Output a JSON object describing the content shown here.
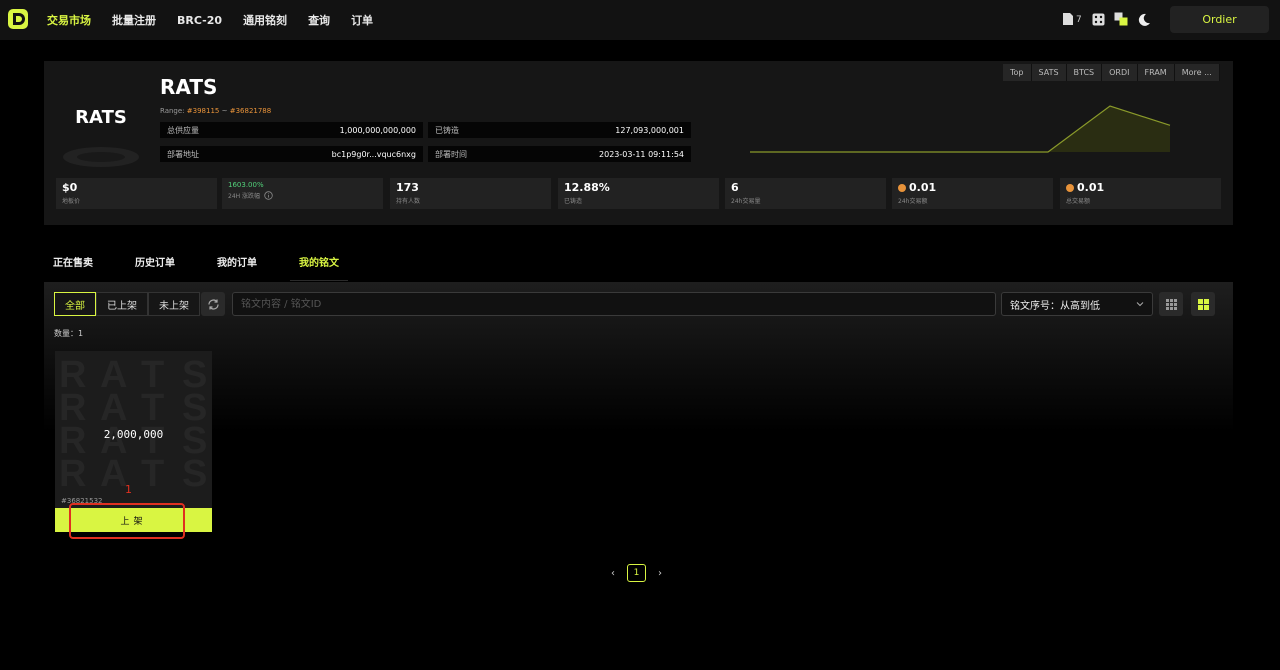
{
  "nav": {
    "items": [
      {
        "label": "交易市场",
        "active": true
      },
      {
        "label": "批量注册",
        "active": false
      },
      {
        "label": "BRC-20",
        "active": false
      },
      {
        "label": "通用铭刻",
        "active": false
      },
      {
        "label": "查询",
        "active": false
      },
      {
        "label": "订单",
        "active": false
      }
    ],
    "doc_count": "7",
    "order_button": "Ordier"
  },
  "token": {
    "logo_text": "RATS",
    "name": "RATS",
    "range_label": "Range:",
    "range_from": "#398115",
    "range_sep": "~",
    "range_to": "#36821788",
    "total_supply_label": "总供应量",
    "total_supply": "1,000,000,000,000",
    "minted_label": "已铸造",
    "minted": "127,093,000,001",
    "deploy_addr_label": "部署地址",
    "deploy_addr": "bc1p9g0r...vquc6nxg",
    "deploy_time_label": "部署时间",
    "deploy_time": "2023-03-11 09:11:54"
  },
  "chart_tabs": [
    "Top",
    "SATS",
    "BTCS",
    "ORDI",
    "FRAM",
    "More ..."
  ],
  "chart_data": {
    "type": "line",
    "x": [
      0,
      1,
      2,
      3
    ],
    "values": [
      0,
      0,
      1,
      0.58
    ],
    "title": "",
    "xlabel": "",
    "ylabel": "",
    "grid": false
  },
  "stats": [
    {
      "value": "$0",
      "label": "地板价"
    },
    {
      "value": "1603.00%",
      "label": "24H 涨跌幅"
    },
    {
      "value": "173",
      "label": "持有人数"
    },
    {
      "value": "12.88%",
      "label": "已铸造"
    },
    {
      "value": "6",
      "label": "24h交易量"
    },
    {
      "value": "0.01",
      "label": "24h交易额"
    },
    {
      "value": "0.01",
      "label": "总交易额"
    }
  ],
  "subtabs": [
    {
      "label": "正在售卖",
      "active": false
    },
    {
      "label": "历史订单",
      "active": false
    },
    {
      "label": "我的订单",
      "active": false
    },
    {
      "label": "我的铭文",
      "active": true
    }
  ],
  "filters": {
    "segments": [
      {
        "label": "全部",
        "active": true
      },
      {
        "label": "已上架",
        "active": false
      },
      {
        "label": "未上架",
        "active": false
      }
    ],
    "search_placeholder": "铭文内容 / 铭文ID",
    "sort_label": "铭文序号：从高到低"
  },
  "count_text": "数量：1",
  "card": {
    "bg_text": "RATS",
    "amount": "2,000,000",
    "inscription_id": "#36821532",
    "button": "上架"
  },
  "annotation": {
    "number": "1"
  },
  "pagination": {
    "current": "1",
    "prev": "‹",
    "next": "›"
  },
  "colors": {
    "accent": "#d9f542",
    "annotation": "#e03020",
    "coin": "#e8933a",
    "positive": "#52d17a"
  }
}
